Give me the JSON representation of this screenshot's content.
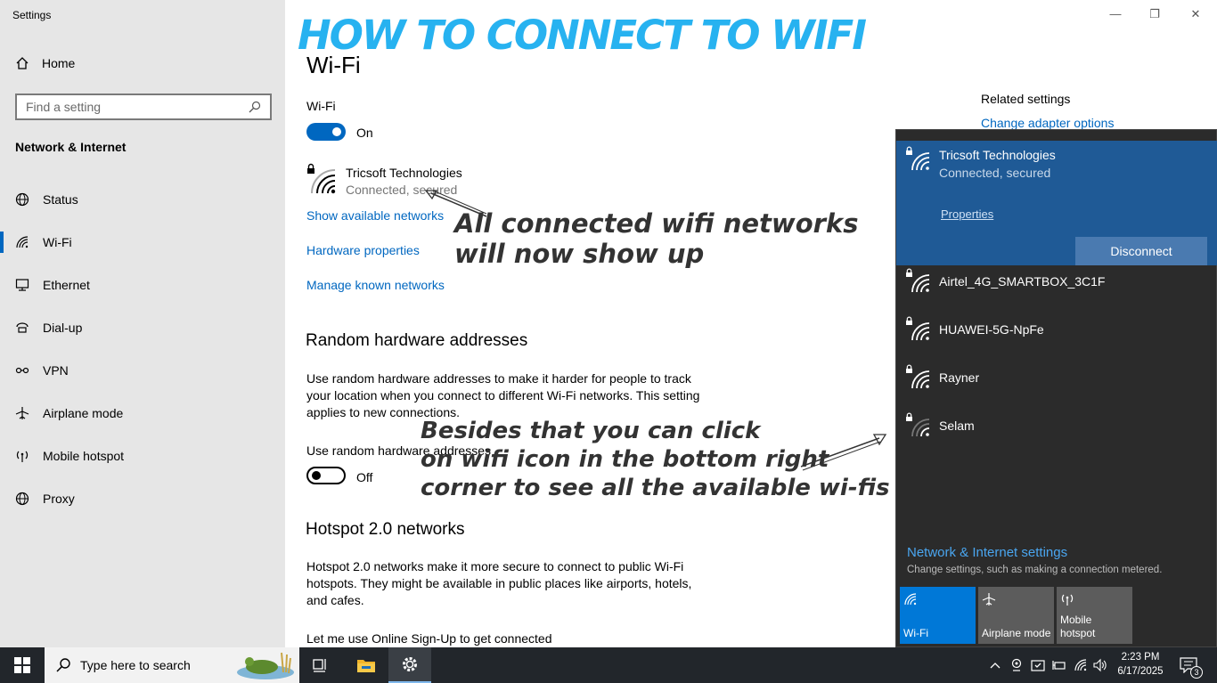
{
  "app": {
    "title": "Settings"
  },
  "overlay": {
    "title": "HOW TO CONNECT TO WIFI",
    "annotation1": [
      "All connected wifi  networks",
      "will  now show up"
    ],
    "annotation2": [
      "Besides that you can click",
      "on wifi icon in the bottom right",
      "corner to see all the available wi-fis"
    ]
  },
  "sidebar": {
    "home": "Home",
    "search_placeholder": "Find a setting",
    "section": "Network & Internet",
    "items": [
      {
        "label": "Status",
        "icon": "globe-icon"
      },
      {
        "label": "Wi-Fi",
        "icon": "wifi-icon",
        "active": true
      },
      {
        "label": "Ethernet",
        "icon": "ethernet-icon"
      },
      {
        "label": "Dial-up",
        "icon": "dialup-icon"
      },
      {
        "label": "VPN",
        "icon": "vpn-icon"
      },
      {
        "label": "Airplane mode",
        "icon": "airplane-icon"
      },
      {
        "label": "Mobile hotspot",
        "icon": "hotspot-icon"
      },
      {
        "label": "Proxy",
        "icon": "globe-icon"
      }
    ]
  },
  "main": {
    "title": "Wi-Fi",
    "wifi_label": "Wi-Fi",
    "wifi_state": "On",
    "network_name": "Tricsoft Technologies",
    "network_status": "Connected, secured",
    "links": [
      "Show available networks",
      "Hardware properties",
      "Manage known networks"
    ],
    "random_title": "Random hardware addresses",
    "random_desc": [
      "Use random hardware addresses to make it harder for people to track",
      "your location when you connect to different Wi-Fi networks. This setting",
      "applies to new connections."
    ],
    "random_label": "Use random hardware addresses",
    "random_state": "Off",
    "hotspot_title": "Hotspot 2.0 networks",
    "hotspot_desc": [
      "Hotspot 2.0 networks make it more secure to connect to public Wi-Fi",
      "hotspots. They might be available in public places like airports, hotels,",
      "and cafes."
    ],
    "online_signup": "Let me use Online Sign-Up to get connected",
    "related_title": "Related settings",
    "related_link": "Change adapter options"
  },
  "flyout": {
    "connected": {
      "name": "Tricsoft Technologies",
      "status": "Connected, secured",
      "properties": "Properties",
      "disconnect": "Disconnect"
    },
    "networks": [
      "Airtel_4G_SMARTBOX_3C1F",
      "HUAWEI-5G-NpFe",
      "Rayner",
      "Selam"
    ],
    "settings_link": "Network & Internet settings",
    "settings_hint": "Change settings, such as making a connection metered.",
    "tiles": [
      {
        "label": "Wi-Fi",
        "active": true
      },
      {
        "label": "Airplane mode",
        "active": false
      },
      {
        "label": "Mobile hotspot",
        "active": false
      }
    ],
    "colors": {
      "panel": "#2b2b2b",
      "connected": "#1f5a96",
      "accent": "#0078d7"
    }
  },
  "taskbar": {
    "search_placeholder": "Type here to search",
    "time": "2:23 PM",
    "date": "6/17/2025",
    "notifications": "3"
  }
}
